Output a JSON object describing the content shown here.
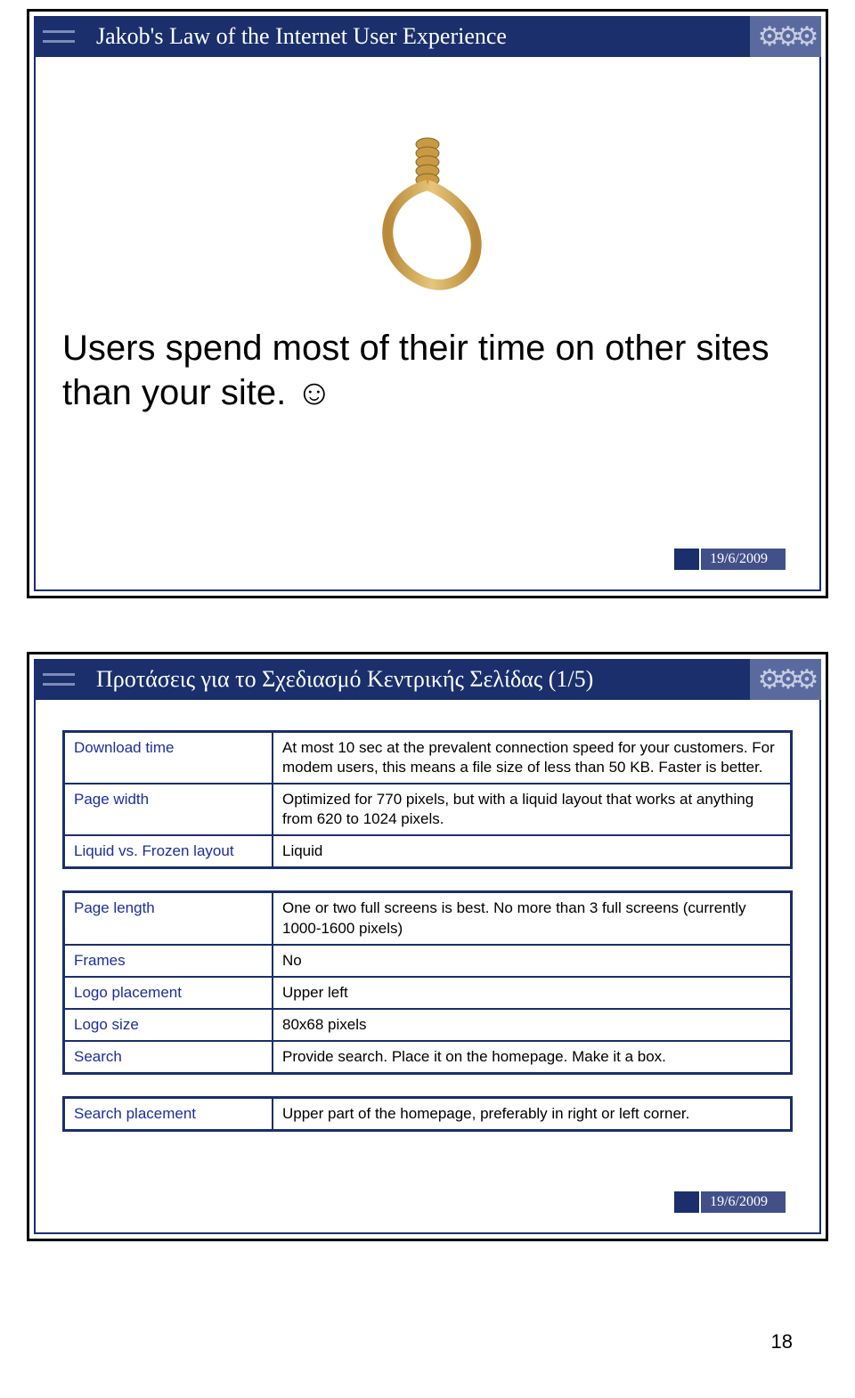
{
  "slide1": {
    "title": "Jakob's Law of the Internet User Experience",
    "quote": "Users spend most of their time on other sites than your site. ☺",
    "date": "19/6/2009"
  },
  "slide2": {
    "title": "Προτάσεις για το Σχεδιασμό Κεντρικής Σελίδας (1/5)",
    "tableA": [
      {
        "label": "Download time",
        "value": "At most 10 sec at the prevalent connection speed for your customers. For modem users, this means a file size of less than 50 KB. Faster is better."
      },
      {
        "label": "Page width",
        "value": "Optimized for 770 pixels, but with a liquid layout that works at anything from 620 to 1024 pixels."
      },
      {
        "label": "Liquid vs. Frozen layout",
        "value": "Liquid"
      }
    ],
    "tableB": [
      {
        "label": "Page length",
        "value": "One or two full screens is best. No more than 3 full screens (currently 1000-1600 pixels)"
      },
      {
        "label": "Frames",
        "value": "No"
      },
      {
        "label": "Logo placement",
        "value": "Upper left"
      },
      {
        "label": "Logo size",
        "value": "80x68 pixels"
      },
      {
        "label": "Search",
        "value": "Provide search. Place it on the homepage. Make it a box."
      }
    ],
    "tableC": [
      {
        "label": "Search placement",
        "value": "Upper part of the homepage, preferably in right or left corner."
      }
    ],
    "date": "19/6/2009"
  },
  "pageNumber": "18"
}
